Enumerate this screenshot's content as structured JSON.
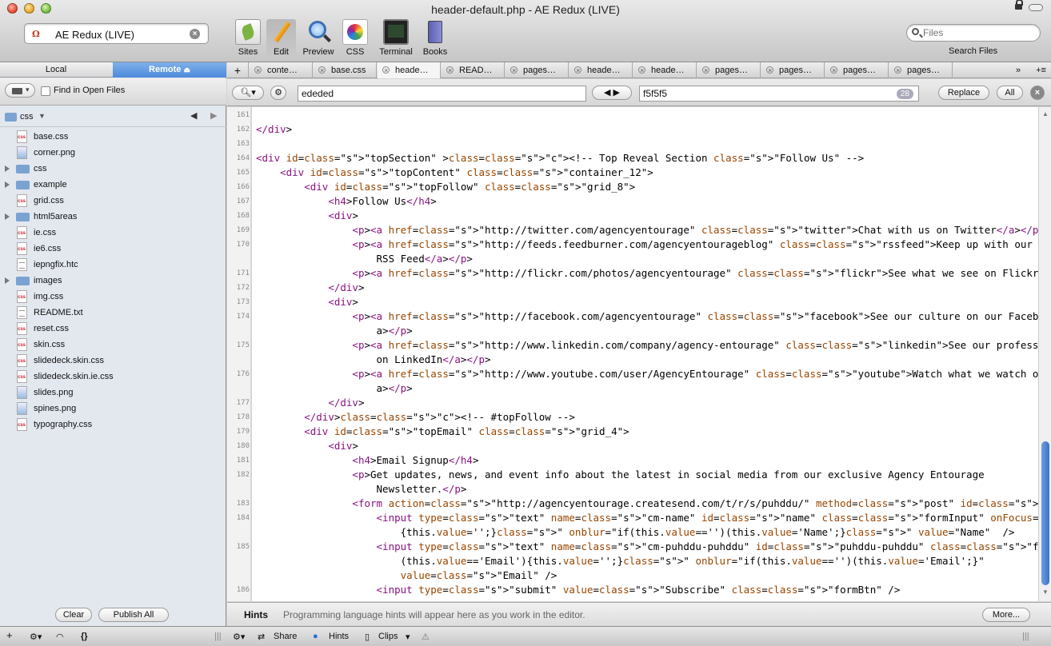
{
  "window": {
    "title": "header-default.php - AE Redux (LIVE)"
  },
  "site": {
    "label": "AE Redux (LIVE)",
    "icon": "site-logo-icon"
  },
  "toolbar": {
    "items": [
      "Sites",
      "Edit",
      "Preview",
      "CSS",
      "Terminal",
      "Books"
    ],
    "selected": "Edit"
  },
  "search": {
    "placeholder": "Files",
    "label": "Search Files"
  },
  "left": {
    "tab_local": "Local",
    "tab_remote": "Remote",
    "find_label": "Find in Open Files",
    "folder": "css",
    "files": [
      {
        "name": "base.css",
        "kind": "css"
      },
      {
        "name": "corner.png",
        "kind": "img"
      },
      {
        "name": "css",
        "kind": "dir"
      },
      {
        "name": "example",
        "kind": "dir"
      },
      {
        "name": "grid.css",
        "kind": "css"
      },
      {
        "name": "html5areas",
        "kind": "dir"
      },
      {
        "name": "ie.css",
        "kind": "css"
      },
      {
        "name": "ie6.css",
        "kind": "css"
      },
      {
        "name": "iepngfix.htc",
        "kind": "txt"
      },
      {
        "name": "images",
        "kind": "dir"
      },
      {
        "name": "img.css",
        "kind": "css"
      },
      {
        "name": "README.txt",
        "kind": "txt"
      },
      {
        "name": "reset.css",
        "kind": "css"
      },
      {
        "name": "skin.css",
        "kind": "css"
      },
      {
        "name": "slidedeck.skin.css",
        "kind": "css"
      },
      {
        "name": "slidedeck.skin.ie.css",
        "kind": "css"
      },
      {
        "name": "slides.png",
        "kind": "img"
      },
      {
        "name": "spines.png",
        "kind": "img"
      },
      {
        "name": "typography.css",
        "kind": "css"
      }
    ],
    "clear": "Clear",
    "publish": "Publish All"
  },
  "tabs": [
    "conte…",
    "base.css",
    "heade…",
    "READ…",
    "pages…",
    "heade…",
    "heade…",
    "pages…",
    "pages…",
    "pages…",
    "pages…"
  ],
  "find": {
    "search": "ededed",
    "replace_value": "f5f5f5",
    "count": "28",
    "replace": "Replace",
    "all": "All"
  },
  "code": [
    {
      "n": "161",
      "t": ""
    },
    {
      "n": "162",
      "t": "</div>"
    },
    {
      "n": "163",
      "t": ""
    },
    {
      "n": "164",
      "t": "<div id=\"topSection\" ><!-- Top Reveal Section \"Follow Us\" -->"
    },
    {
      "n": "165",
      "t": "    <div id=\"topContent\" class=\"container_12\">"
    },
    {
      "n": "166",
      "t": "        <div id=\"topFollow\" class=\"grid_8\">"
    },
    {
      "n": "167",
      "t": "            <h4>Follow Us</h4>"
    },
    {
      "n": "168",
      "t": "            <div>"
    },
    {
      "n": "169",
      "t": "                <p><a href=\"http://twitter.com/agencyentourage\" class=\"twitter\">Chat with us on Twitter</a></p>"
    },
    {
      "n": "170",
      "t": "                <p><a href=\"http://feeds.feedburner.com/agencyentourageblog\" class=\"rssfeed\">Keep up with our Ideas via"
    },
    {
      "n": "",
      "t": "                    RSS Feed</a></p>"
    },
    {
      "n": "171",
      "t": "                <p><a href=\"http://flickr.com/photos/agencyentourage\" class=\"flickr\">See what we see on Flickr</a></p>"
    },
    {
      "n": "172",
      "t": "            </div>"
    },
    {
      "n": "173",
      "t": "            <div>"
    },
    {
      "n": "174",
      "t": "                <p><a href=\"http://facebook.com/agencyentourage\" class=\"facebook\">See our culture on our Facebook page</"
    },
    {
      "n": "",
      "t": "                    a></p>"
    },
    {
      "n": "175",
      "t": "                <p><a href=\"http://www.linkedin.com/company/agency-entourage\" class=\"linkedin\">See our professional side"
    },
    {
      "n": "",
      "t": "                    on LinkedIn</a></p>"
    },
    {
      "n": "176",
      "t": "                <p><a href=\"http://www.youtube.com/user/AgencyEntourage\" class=\"youtube\">Watch what we watch on YouTube</"
    },
    {
      "n": "",
      "t": "                    a></p>"
    },
    {
      "n": "177",
      "t": "            </div>"
    },
    {
      "n": "178",
      "t": "        </div><!-- #topFollow -->"
    },
    {
      "n": "179",
      "t": "        <div id=\"topEmail\" class=\"grid_4\">"
    },
    {
      "n": "180",
      "t": "            <div>"
    },
    {
      "n": "181",
      "t": "                <h4>Email Signup</h4>"
    },
    {
      "n": "182",
      "t": "                <p>Get updates, news, and event info about the latest in social media from our exclusive Agency Entourage"
    },
    {
      "n": "",
      "t": "                    Newsletter.</p>"
    },
    {
      "n": "183",
      "t": "                <form action=\"http://agencyentourage.createsend.com/t/r/s/puhddu/\" method=\"post\" id=\"subForm\">"
    },
    {
      "n": "184",
      "t": "                    <input type=\"text\" name=\"cm-name\" id=\"name\" class=\"formInput\" onFocus=\"if(this.value=='Name')"
    },
    {
      "n": "",
      "t": "                        {this.value='';}\" onblur=\"if(this.value=='')(this.value='Name';}\" value=\"Name\"  />"
    },
    {
      "n": "185",
      "t": "                    <input type=\"text\" name=\"cm-puhddu-puhddu\" id=\"puhddu-puhddu\" class=\"formInput\" onFocus=\"if"
    },
    {
      "n": "",
      "t": "                        (this.value=='Email'){this.value='';}\" onblur=\"if(this.value=='')(this.value='Email';}\""
    },
    {
      "n": "",
      "t": "                        value=\"Email\" />"
    },
    {
      "n": "186",
      "t": "                    <input type=\"submit\" value=\"Subscribe\" class=\"formBtn\" />"
    }
  ],
  "hints": {
    "title": "Hints",
    "text": "Programming language hints will appear here as you work in the editor.",
    "more": "More..."
  },
  "status": {
    "share": "Share",
    "hints": "Hints",
    "clips": "Clips"
  }
}
